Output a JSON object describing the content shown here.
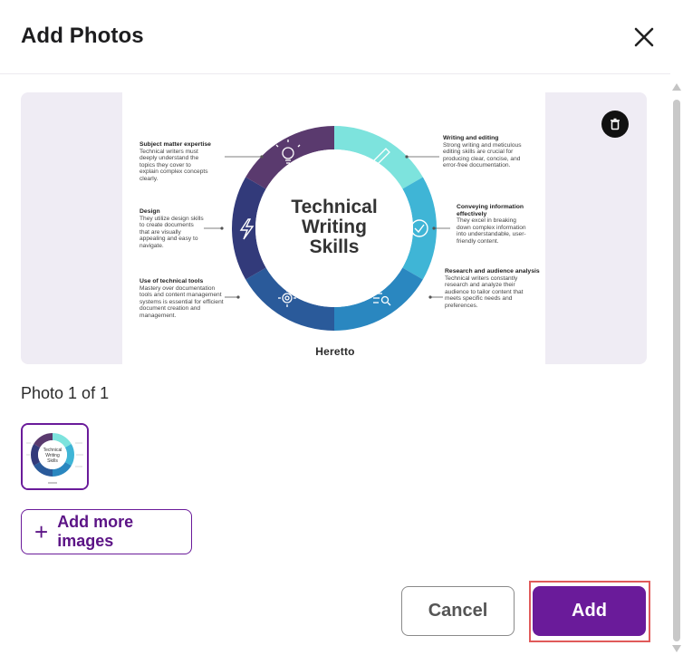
{
  "dialog": {
    "title": "Add Photos",
    "close_icon": "close-icon"
  },
  "preview": {
    "delete_icon": "trash-icon",
    "infographic": {
      "center_title": [
        "Technical",
        "Writing",
        "Skills"
      ],
      "brand": "Heretto",
      "left_items": [
        {
          "title": "Subject matter expertise",
          "lines": [
            "Technical writers must",
            "deeply understand the",
            "topics they cover to",
            "explain complex concepts",
            "clearly."
          ]
        },
        {
          "title": "Design",
          "lines": [
            "They utilize design skills",
            "to create documents",
            "that are visually",
            "appealing and easy to",
            "navigate."
          ]
        },
        {
          "title": "Use of technical tools",
          "lines": [
            "Mastery over documentation",
            "tools and content management",
            "systems is essential for efficient",
            "document creation and",
            "management."
          ]
        }
      ],
      "right_items": [
        {
          "title": "Writing and editing",
          "lines": [
            "Strong writing and meticulous",
            "editing skills are crucial for",
            "producing clear, concise, and",
            "error-free documentation."
          ]
        },
        {
          "title": "Conveying information effectively",
          "lines": [
            "They excel in breaking",
            "down complex information",
            "into understandable, user-",
            "friendly content."
          ]
        },
        {
          "title": "Research and audience analysis",
          "lines": [
            "Technical writers constantly",
            "research and analyze their",
            "audience to tailor content that",
            "meets specific needs and",
            "preferences."
          ]
        }
      ],
      "segment_colors": [
        "#7de3dd",
        "#3fb5d6",
        "#2a87c0",
        "#2a5a9a",
        "#323a7a",
        "#5a3a6e"
      ]
    }
  },
  "gallery": {
    "counter": "Photo 1 of 1",
    "add_more_label": "Add more images"
  },
  "footer": {
    "cancel_label": "Cancel",
    "add_label": "Add"
  },
  "colors": {
    "accent": "#6a1b9a",
    "highlight": "#e05a5a"
  }
}
